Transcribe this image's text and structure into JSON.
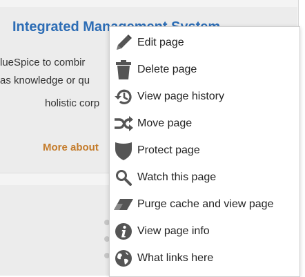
{
  "page": {
    "title": "Integrated Management System",
    "body_line1": "lueSpice to combir",
    "body_line2": "as knowledge or qu",
    "body_line3": "holistic corp",
    "more_link": "More about"
  },
  "menu": {
    "items": [
      {
        "label": "Edit page",
        "icon": "pencil-icon"
      },
      {
        "label": "Delete page",
        "icon": "trash-icon"
      },
      {
        "label": "View page history",
        "icon": "history-icon"
      },
      {
        "label": "Move page",
        "icon": "move-icon"
      },
      {
        "label": "Protect page",
        "icon": "shield-icon"
      },
      {
        "label": "Watch this page",
        "icon": "search-icon"
      },
      {
        "label": "Purge cache and view page",
        "icon": "eraser-icon"
      },
      {
        "label": "View page info",
        "icon": "info-icon"
      },
      {
        "label": "What links here",
        "icon": "globe-icon"
      }
    ]
  },
  "colors": {
    "title_blue": "#2d6db5",
    "more_orange": "#c47b2a",
    "icon_gray": "#555555"
  }
}
